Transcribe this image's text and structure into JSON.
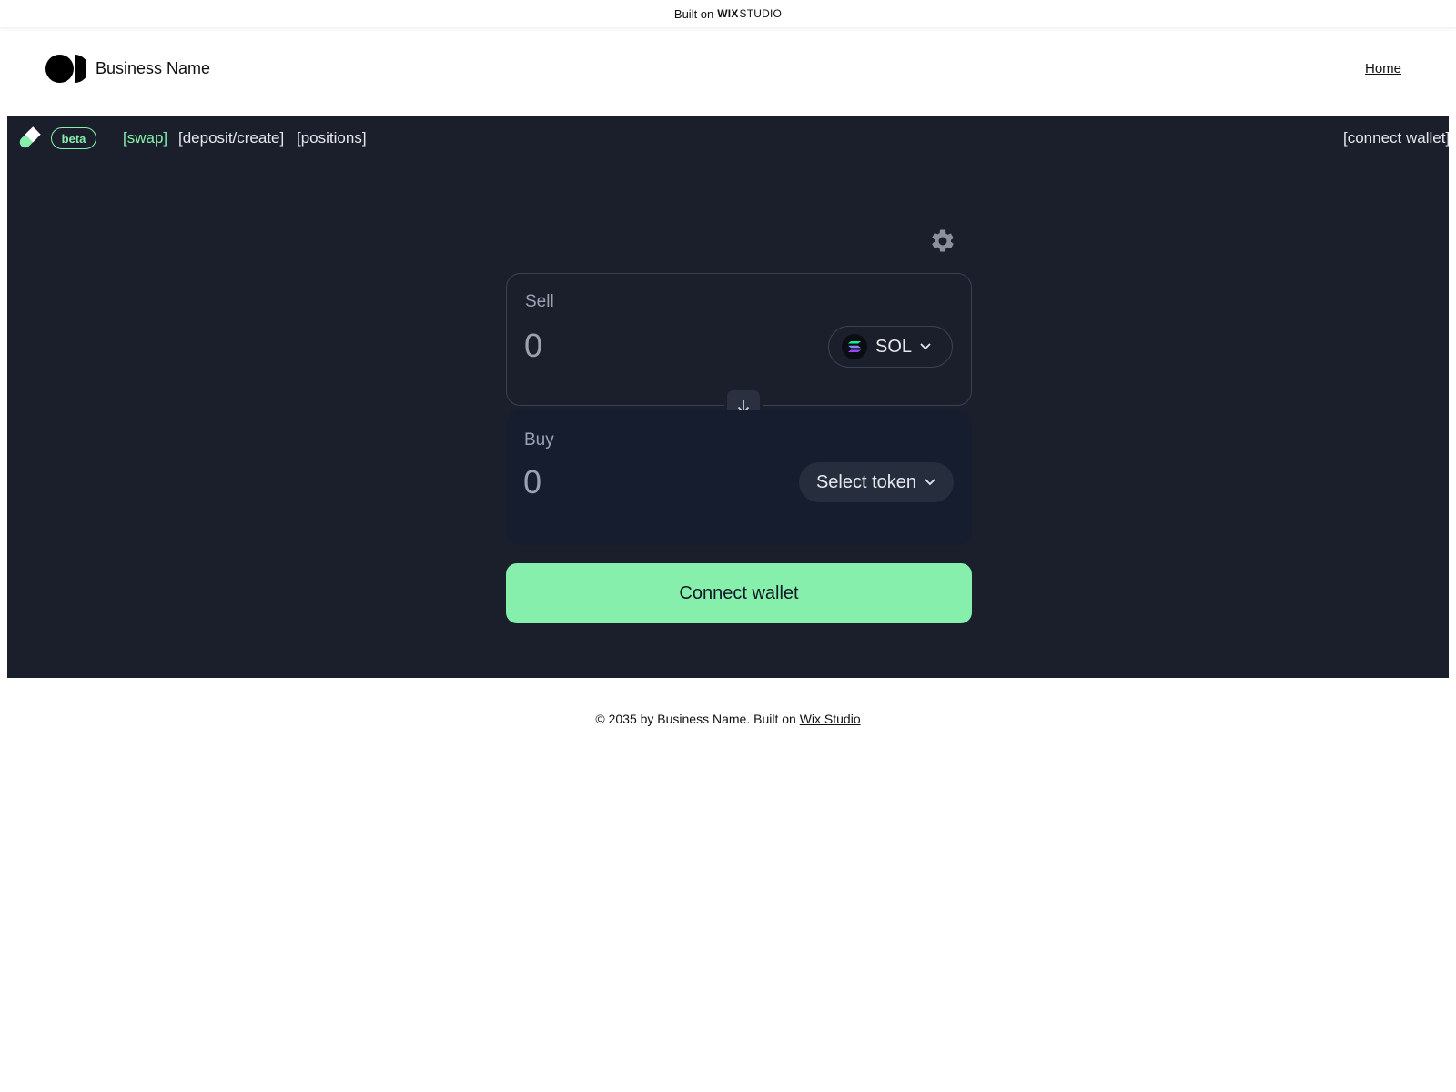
{
  "banner": {
    "built_on": "Built on",
    "wix": "WIX",
    "studio": "STUDIO"
  },
  "header": {
    "brand_name": "Business Name",
    "nav_home": "Home"
  },
  "app": {
    "beta_badge": "beta",
    "nav": {
      "swap": "[swap]",
      "deposit_create": "[deposit/create]",
      "positions": "[positions]",
      "connect_wallet": "[connect wallet]"
    },
    "sell": {
      "label": "Sell",
      "amount": "0",
      "token": "SOL"
    },
    "buy": {
      "label": "Buy",
      "amount": "0",
      "select_token": "Select token"
    },
    "connect_button": "Connect wallet",
    "colors": {
      "background": "#1b1f2b",
      "accent_green": "#86efac",
      "buy_card": "#161d2e"
    }
  },
  "footer": {
    "text": "© 2035 by Business Name. Built on",
    "link": "Wix Studio"
  }
}
